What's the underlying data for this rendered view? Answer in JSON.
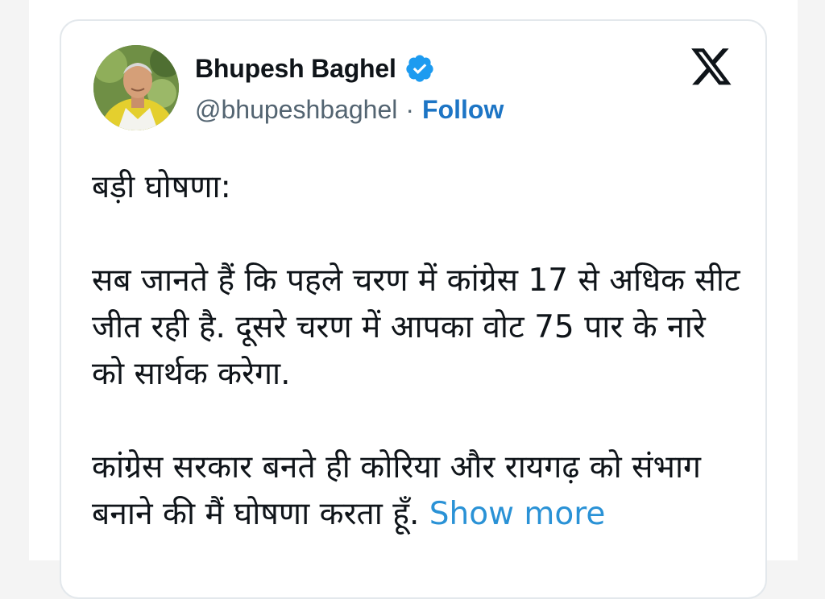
{
  "author": {
    "name": "Bhupesh Baghel",
    "handle": "@bhupeshbaghel",
    "separator": "·",
    "follow_label": "Follow"
  },
  "icons": {
    "verified": "verified-badge-icon",
    "platform": "x-logo-icon"
  },
  "colors": {
    "follow": "#1d75c5",
    "show_more": "#2a92d6",
    "verified": "#1d9bf0",
    "text": "#0f1419",
    "secondary": "#536471"
  },
  "tweet": {
    "heading": "बड़ी घोषणा:",
    "paragraph_1": "सब जानते हैं कि पहले चरण में कांग्रेस 17 से अधिक सीट जीत रही है. दूसरे चरण में आपका वोट 75 पार के नारे को सार्थक करेगा.",
    "paragraph_2": "कांग्रेस सरकार बनते ही कोरिया और रायगढ़ को संभाग बनाने की मैं घोषणा करता हूँ.",
    "show_more_label": "Show more"
  }
}
